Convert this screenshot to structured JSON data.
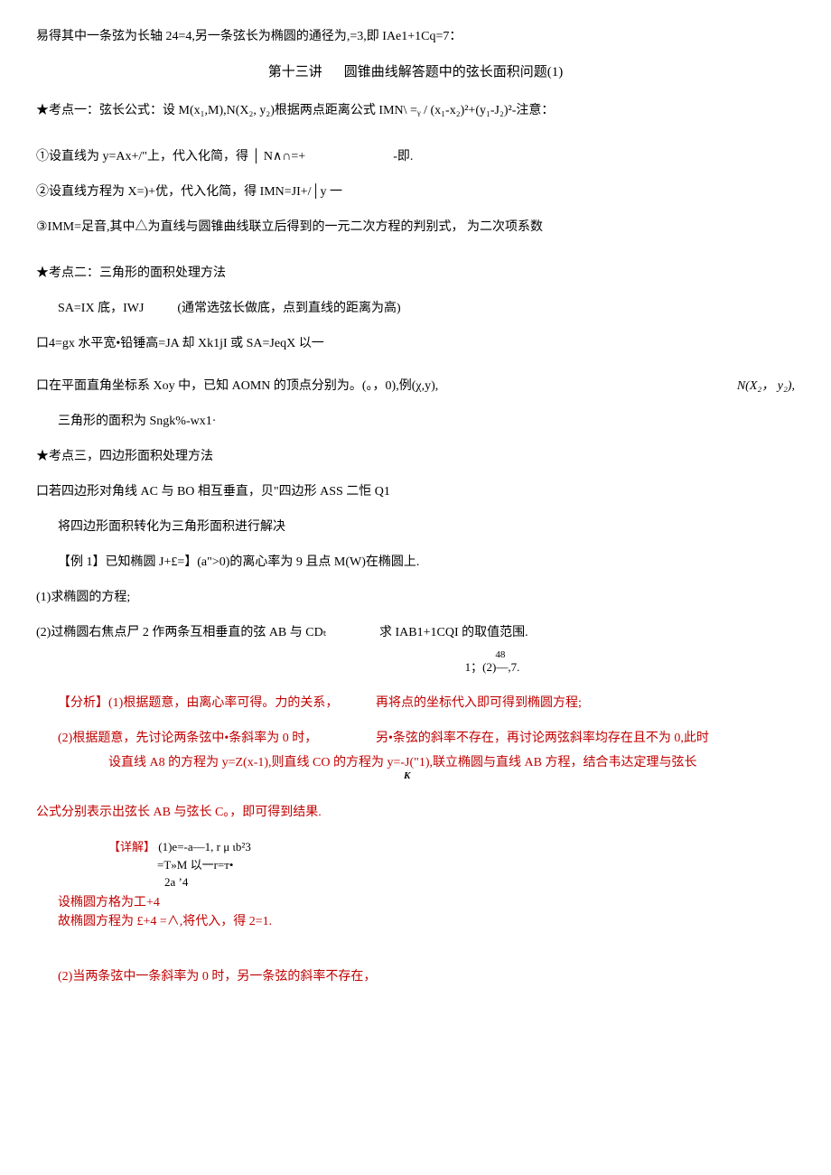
{
  "intro": "易得其中一条弦为长轴 24=4,另一条弦长为椭圆的通径为,=3,即 IAe1+1Cq=7：",
  "title_a": "第十三讲",
  "title_b": "圆锥曲线解答题中的弦长面积问题(1)",
  "kp1": {
    "head": "★考点一：弦长公式：设 M(x₁,M),N(X₂, y₂)根据两点距离公式 IMN\\ =ᵧ / (x₁-x₂)²+(y₁-J₂)²-注意：",
    "p1": "①设直线为 y=Ax+/\"上，代入化简，得 │ N∧∩=+",
    "p1_tail": "-即.",
    "p2": "②设直线方程为 X=)+优，代入化简，得 IMN=JI+/│y 一",
    "p3": "③IMM=足音,其中△为直线与圆锥曲线联立后得到的一元二次方程的判别式， 为二次项系数"
  },
  "kp2": {
    "head": "★考点二：三角形的面积处理方法",
    "r1_a": "SA=IX 底，IWJ",
    "r1_b": "(通常选弦长做底，点到直线的距离为高)",
    "r2": "口4=gx 水平宽•铅锤高=JA 却 Xk1jI 或 SA=JeqX 以一",
    "r3_a": "口在平面直角坐标系 Xoy 中，已知 AOMN 的顶点分别为。(。，0),例(χ,y),",
    "r3_b": "N(X₂， y₂),",
    "r4": "三角形的面积为 Sngk%-wx1·"
  },
  "kp3": {
    "head": "★考点三，四边形面积处理方法",
    "r1": "口若四边形对角线 AC 与 BO 相互垂直，贝\"四边形 ASS 二怇 Q1",
    "r2": "将四边形面积转化为三角形面积进行解决"
  },
  "ex1": {
    "stem": "【例 1】已知椭圆 J+£=】(a\">0)的离心率为 9 且点 M(W)在椭圆上.",
    "q1": "(1)求椭圆的方程;",
    "q2_left": "(2)过椭圆右焦点尸 2 作两条互相垂直的弦 AB 与 CDₜ",
    "q2_right": "求 IAB1+1CQI 的取值范围.",
    "ans_hint": "1；(2)—,7.",
    "ans_num": "48"
  },
  "analysis": {
    "l1_a": "【分析】(1)根据题意，由离心率可得。力的关系，",
    "l1_b": "再将点的坐标代入即可得到椭圆方程;",
    "l2_a": "(2)根据题意，先讨论两条弦中•条斜率为 0 时，",
    "l2_b": "另•条弦的斜率不存在，再讨论两弦斜率均存在且不为 0,此时",
    "l3_a": "设直线 A8 的方程为 y=Z(x-1),则直线 CO 的方程为 y=-J(\"1),",
    "l3_b_italic": "K",
    "l3_c": "联立椭圆与直线 AB 方程，结合韦达定理与弦长",
    "l4": "公式分别表示出弦长 AB 与弦长 C。，即可得到结果."
  },
  "detail": {
    "head": "【详解】",
    "f1": "(1)e=-a—1, r μ ιb²3",
    "f2": "=T»M 以一r=т•",
    "f3": "2a ʼ4",
    "d1": "设椭圆方格为工+4",
    "d2": "故椭圆方程为 £+4   =∧,将代入，得 2=1.",
    "d3": "(2)当两条弦中一条斜率为 0 时，另一条弦的斜率不存在，"
  }
}
